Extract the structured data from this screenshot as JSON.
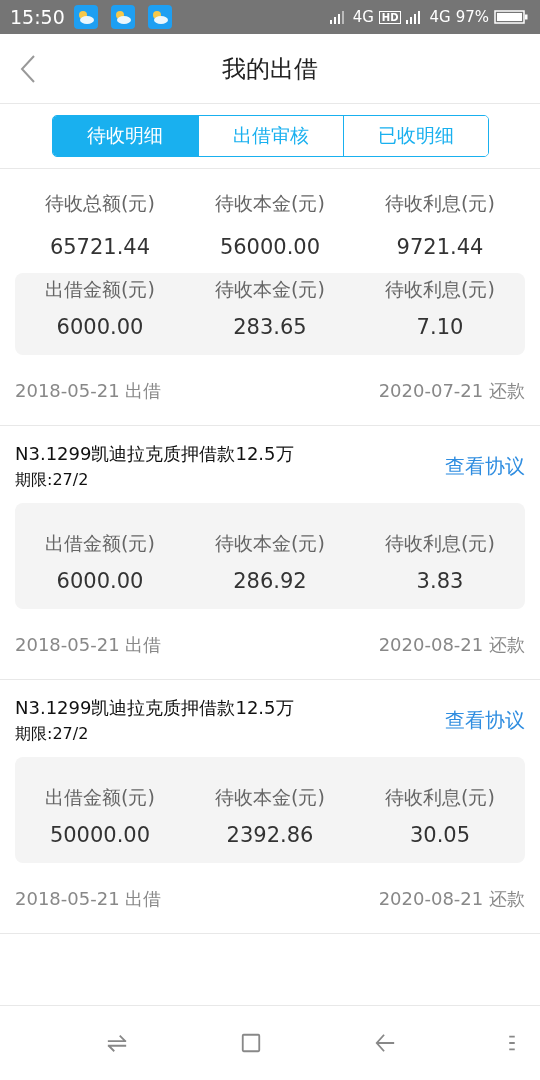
{
  "status_bar": {
    "time": "15:50",
    "network_1": "4G",
    "hd": "HD",
    "network_2": "4G",
    "battery": "97%"
  },
  "header": {
    "title": "我的出借"
  },
  "tabs": [
    {
      "label": "待收明细",
      "selected": true
    },
    {
      "label": "出借审核",
      "selected": false
    },
    {
      "label": "已收明细",
      "selected": false
    }
  ],
  "summary": [
    {
      "label": "待收总额(元)",
      "value": "65721.44"
    },
    {
      "label": "待收本金(元)",
      "value": "56000.00"
    },
    {
      "label": "待收利息(元)",
      "value": "9721.44"
    }
  ],
  "loans": [
    {
      "stats": [
        {
          "label": "出借金额(元)",
          "value": "6000.00"
        },
        {
          "label": "待收本金(元)",
          "value": "283.65"
        },
        {
          "label": "待收利息(元)",
          "value": "7.10"
        }
      ],
      "lent_date": "2018-05-21 出借",
      "repay_date": "2020-07-21 还款"
    },
    {
      "title": "N3.1299凯迪拉克质押借款12.5万",
      "term": "期限:27/2",
      "link": "查看协议",
      "stats": [
        {
          "label": "出借金额(元)",
          "value": "6000.00"
        },
        {
          "label": "待收本金(元)",
          "value": "286.92"
        },
        {
          "label": "待收利息(元)",
          "value": "3.83"
        }
      ],
      "lent_date": "2018-05-21 出借",
      "repay_date": "2020-08-21 还款"
    },
    {
      "title": "N3.1299凯迪拉克质押借款12.5万",
      "term": "期限:27/2",
      "link": "查看协议",
      "stats": [
        {
          "label": "出借金额(元)",
          "value": "50000.00"
        },
        {
          "label": "待收本金(元)",
          "value": "2392.86"
        },
        {
          "label": "待收利息(元)",
          "value": "30.05"
        }
      ],
      "lent_date": "2018-05-21 出借",
      "repay_date": "2020-08-21 还款"
    }
  ]
}
